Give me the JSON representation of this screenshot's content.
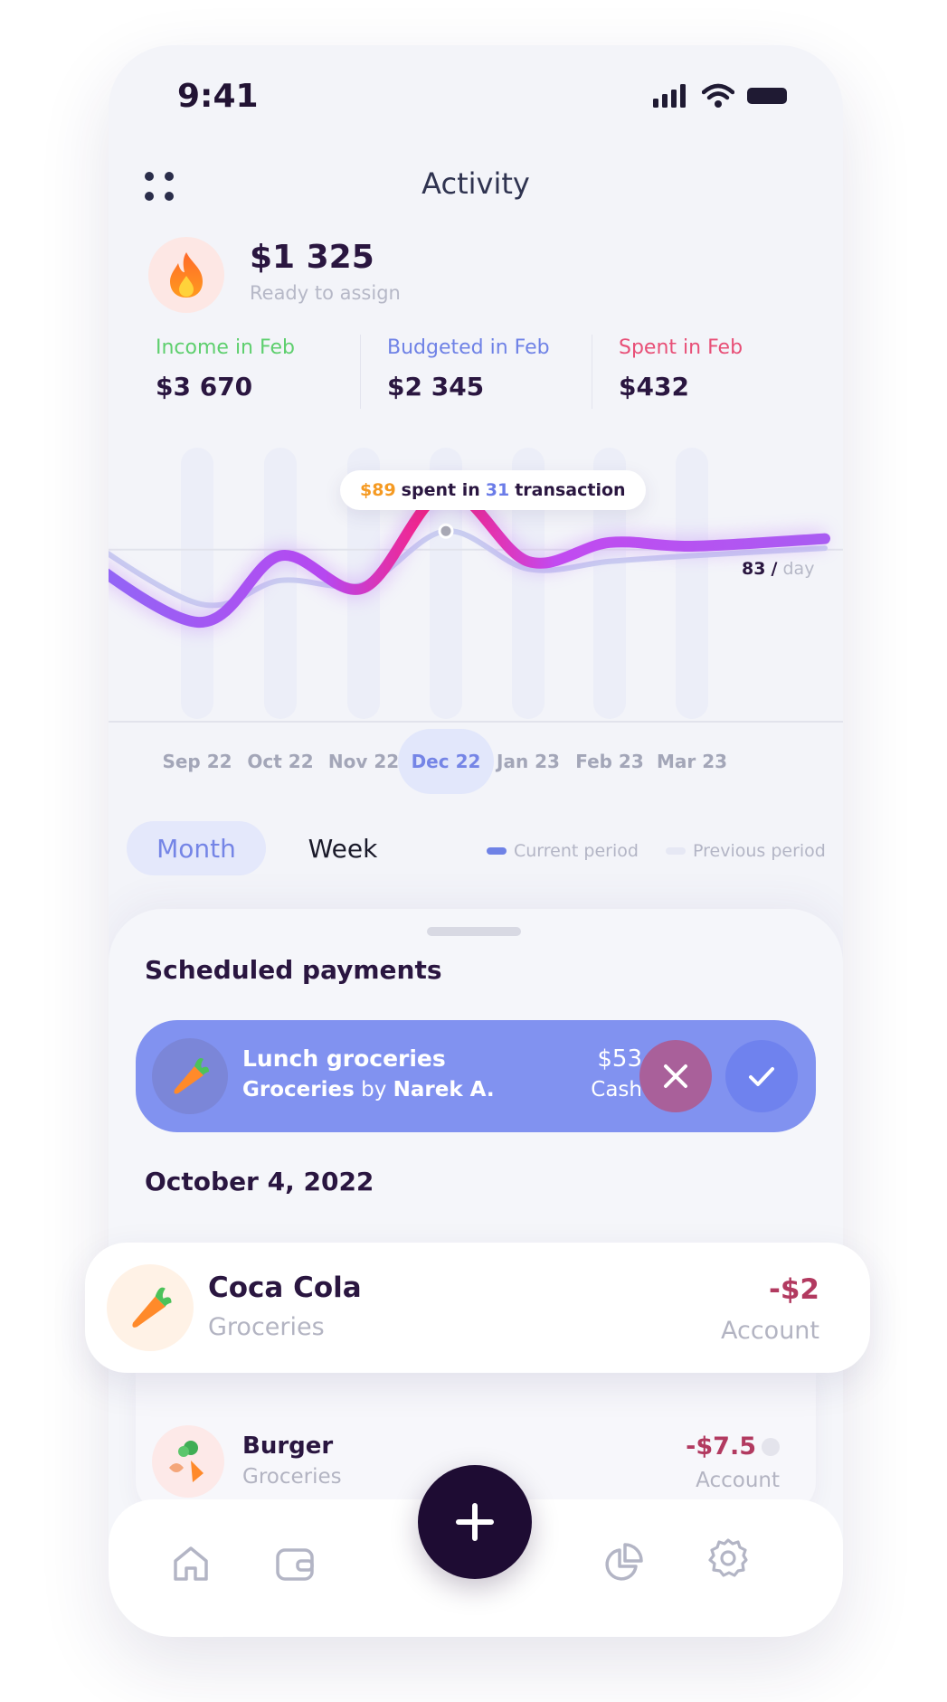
{
  "status_bar": {
    "time": "9:41"
  },
  "header": {
    "title": "Activity"
  },
  "balance": {
    "amount": "$1 325",
    "label": "Ready to assign"
  },
  "stats": [
    {
      "label": "Income in Feb",
      "value": "$3 670",
      "color": "#5ecf6e"
    },
    {
      "label": "Budgeted in Feb",
      "value": "$2 345",
      "color": "#6f82e6"
    },
    {
      "label": "Spent in Feb",
      "value": "$432",
      "color": "#e84f77"
    }
  ],
  "tooltip": {
    "amount": "$89",
    "text1": "spent in",
    "count": "31",
    "text2": "transaction"
  },
  "average": {
    "value": "83",
    "sep": "/",
    "unit": "day"
  },
  "chart_data": {
    "type": "line",
    "categories": [
      "Sep 22",
      "Oct 22",
      "Nov 22",
      "Dec 22",
      "Jan 23",
      "Feb 23",
      "Mar 23"
    ],
    "selected_category": "Dec 22",
    "series": [
      {
        "name": "Current period",
        "values": [
          20,
          55,
          38,
          89,
          52,
          62,
          60
        ]
      },
      {
        "name": "Previous period",
        "values": [
          30,
          42,
          40,
          68,
          48,
          52,
          55
        ]
      }
    ],
    "reference_line": 83,
    "ylim": [
      0,
      100
    ],
    "colors": {
      "current_start": "#a254f2",
      "current_peak": "#ff1f7a",
      "previous": "#c9cdf0",
      "reference": "#e2e3ec"
    }
  },
  "period_toggle": {
    "month": "Month",
    "week": "Week",
    "selected": "Month"
  },
  "legend": {
    "current": "Current  period",
    "previous": "Previous period"
  },
  "scheduled": {
    "title": "Scheduled payments",
    "item": {
      "name": "Lunch groceries",
      "category": "Groceries",
      "by": "by",
      "person": "Narek A.",
      "amount": "$53",
      "method": "Cash"
    }
  },
  "date_header": "October 4, 2022",
  "transactions": [
    {
      "name": "Coca Cola",
      "category": "Groceries",
      "amount": "-$2",
      "account": "Account"
    },
    {
      "name": "Burger",
      "category": "Groceries",
      "amount": "-$7.5",
      "account": "Account"
    }
  ],
  "colors": {
    "accent": "#8192f0",
    "dark": "#1e0c33",
    "negative": "#b23a60"
  },
  "nav_icons": [
    "home-icon",
    "wallet-icon",
    "add-icon",
    "pie-chart-icon",
    "settings-icon"
  ]
}
